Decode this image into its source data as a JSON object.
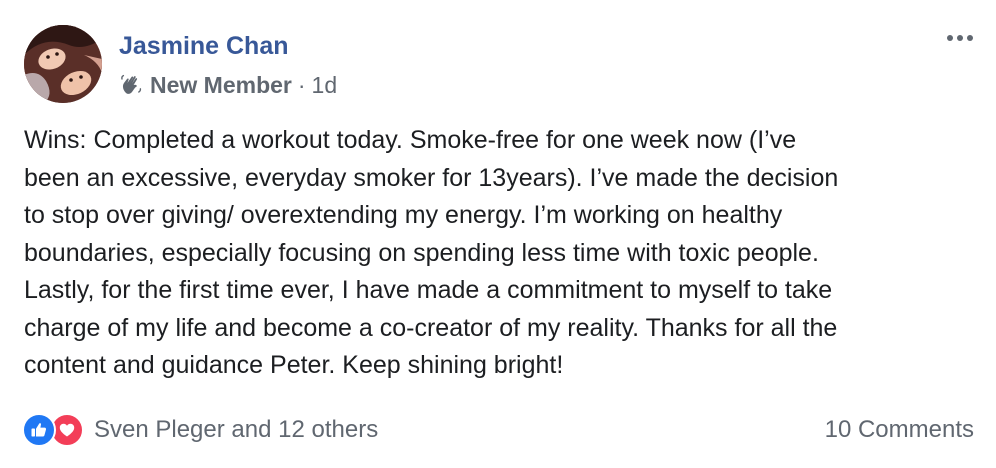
{
  "post": {
    "author": "Jasmine Chan",
    "badge": {
      "icon": "waving-hand-icon",
      "label": "New Member"
    },
    "separator": "·",
    "time": "1d",
    "body": "Wins: Completed a workout today. Smoke-free for one week now (I’ve\nbeen an excessive, everyday smoker for 13years). I’ve made the decision\nto stop over giving/ overextending my energy. I’m working on healthy\nboundaries, especially focusing on spending less time with toxic people.\nLastly, for the first time ever, I have made a commitment to myself to take\ncharge of my life and become a co-creator of my reality. Thanks for all the\ncontent and guidance Peter. Keep shining bright!"
  },
  "reactions": {
    "icons": [
      "like-icon",
      "love-icon"
    ],
    "summary": "Sven Pleger and 12 others"
  },
  "comments": {
    "label": "10 Comments"
  },
  "colors": {
    "author": "#385898",
    "meta": "#606770",
    "text": "#1c1e21",
    "like": "#2078f4",
    "love": "#f33e58"
  }
}
